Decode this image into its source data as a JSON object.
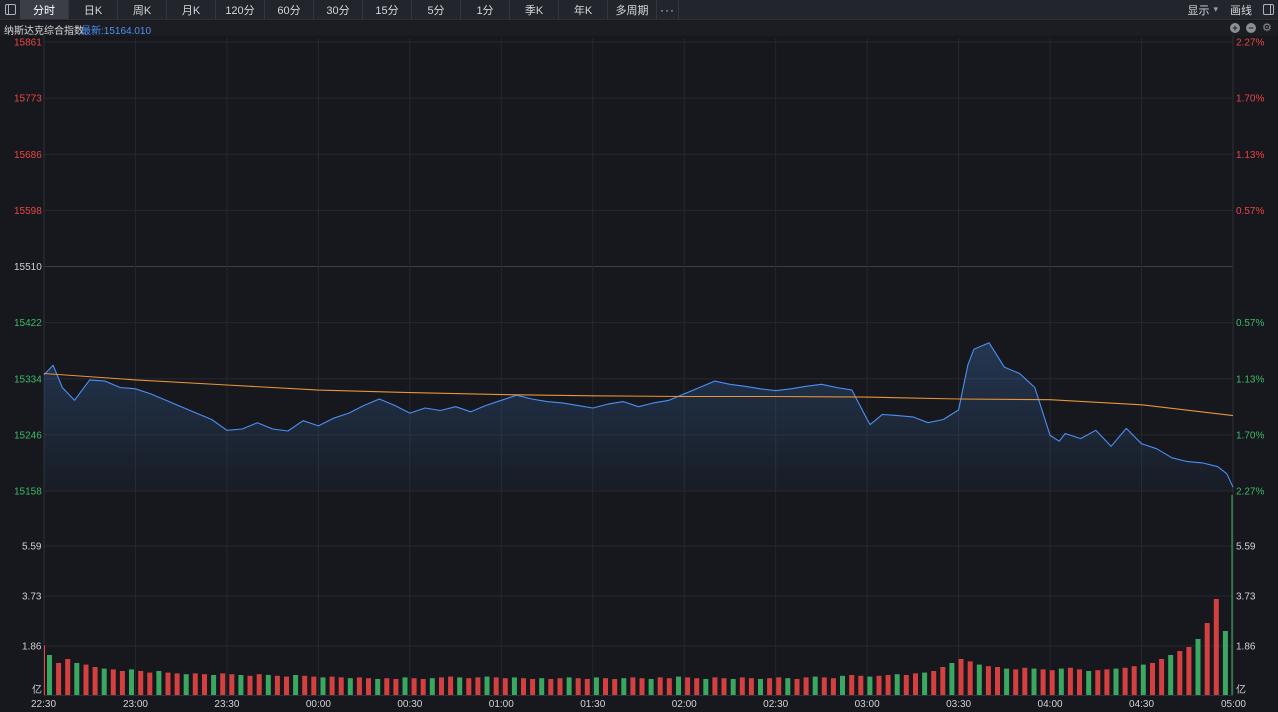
{
  "toolbar": {
    "tabs": [
      "分时",
      "日K",
      "周K",
      "月K",
      "120分",
      "60分",
      "30分",
      "15分",
      "5分",
      "1分",
      "季K",
      "年K",
      "多周期"
    ],
    "more": "···",
    "display": "显示",
    "draw": "画线"
  },
  "info": {
    "name": "纳斯达克综合指数",
    "latest": "最新:15164.010"
  },
  "colors": {
    "price_line": "#4a8ff5",
    "avg_line": "#e8943a",
    "up": "#e94545",
    "down": "#3fb86a",
    "neutral": "#cfd2d7",
    "background": "#16181d"
  },
  "chart_data": {
    "type": "line",
    "x_ticks": [
      "22:30",
      "23:00",
      "23:30",
      "00:00",
      "00:30",
      "01:00",
      "01:30",
      "02:00",
      "02:30",
      "03:00",
      "03:30",
      "04:00",
      "04:30",
      "05:00"
    ],
    "y_labels_left": [
      "15861",
      "15773",
      "15686",
      "15598",
      "15510",
      "15422",
      "15334",
      "15246",
      "15158"
    ],
    "y_labels_right": [
      "2.27%",
      "1.70%",
      "1.13%",
      "0.57%",
      "",
      "0.57%",
      "1.13%",
      "1.70%",
      "2.27%"
    ],
    "y_label_colors": [
      "up",
      "up",
      "up",
      "up",
      "neutral",
      "down",
      "down",
      "down",
      "down"
    ],
    "ylim": [
      15158,
      15861
    ],
    "reference_close": 15510,
    "price": {
      "x": [
        "22:30",
        "22:33",
        "22:36",
        "22:40",
        "22:45",
        "22:50",
        "22:55",
        "23:00",
        "23:05",
        "23:10",
        "23:15",
        "23:20",
        "23:25",
        "23:30",
        "23:35",
        "23:40",
        "23:45",
        "23:50",
        "23:55",
        "00:00",
        "00:05",
        "00:10",
        "00:15",
        "00:20",
        "00:25",
        "00:30",
        "00:35",
        "00:40",
        "00:45",
        "00:50",
        "00:55",
        "01:00",
        "01:05",
        "01:10",
        "01:15",
        "01:20",
        "01:25",
        "01:30",
        "01:35",
        "01:40",
        "01:45",
        "01:50",
        "01:55",
        "02:00",
        "02:05",
        "02:10",
        "02:15",
        "02:20",
        "02:25",
        "02:30",
        "02:35",
        "02:40",
        "02:45",
        "02:50",
        "02:55",
        "03:00",
        "03:01",
        "03:05",
        "03:10",
        "03:15",
        "03:20",
        "03:25",
        "03:30",
        "03:33",
        "03:35",
        "03:40",
        "03:45",
        "03:50",
        "03:55",
        "04:00",
        "04:03",
        "04:05",
        "04:10",
        "04:15",
        "04:20",
        "04:25",
        "04:30",
        "04:35",
        "04:40",
        "04:45",
        "04:50",
        "04:55",
        "04:58",
        "05:00"
      ],
      "y": [
        15340,
        15355,
        15320,
        15300,
        15332,
        15330,
        15320,
        15318,
        15310,
        15300,
        15290,
        15280,
        15270,
        15253,
        15255,
        15265,
        15255,
        15252,
        15268,
        15260,
        15272,
        15280,
        15292,
        15302,
        15292,
        15280,
        15288,
        15284,
        15290,
        15282,
        15292,
        15300,
        15308,
        15302,
        15298,
        15296,
        15292,
        15288,
        15294,
        15298,
        15290,
        15296,
        15300,
        15310,
        15320,
        15330,
        15325,
        15322,
        15318,
        15315,
        15318,
        15322,
        15325,
        15320,
        15316,
        15270,
        15262,
        15278,
        15276,
        15274,
        15265,
        15270,
        15285,
        15355,
        15380,
        15390,
        15352,
        15342,
        15320,
        15245,
        15236,
        15248,
        15240,
        15253,
        15228,
        15256,
        15232,
        15224,
        15210,
        15204,
        15202,
        15196,
        15185,
        15164
      ]
    },
    "average": {
      "x": [
        "22:30",
        "23:00",
        "23:30",
        "00:00",
        "00:30",
        "01:00",
        "01:30",
        "02:00",
        "02:30",
        "03:00",
        "03:30",
        "04:00",
        "04:30",
        "05:00"
      ],
      "y": [
        15342,
        15332,
        15324,
        15316,
        15312,
        15309,
        15307,
        15306,
        15306,
        15305,
        15302,
        15301,
        15293,
        15276
      ]
    },
    "volume_labels": [
      "5.59",
      "3.73",
      "1.86"
    ],
    "volume_unit": "亿",
    "volume": [
      0.5,
      0.4,
      0.45,
      0.4,
      0.38,
      0.35,
      0.33,
      0.32,
      0.3,
      0.32,
      0.3,
      0.28,
      0.3,
      0.28,
      0.27,
      0.26,
      0.27,
      0.26,
      0.25,
      0.27,
      0.26,
      0.25,
      0.24,
      0.26,
      0.25,
      0.24,
      0.23,
      0.25,
      0.24,
      0.23,
      0.22,
      0.23,
      0.22,
      0.21,
      0.22,
      0.21,
      0.2,
      0.21,
      0.2,
      0.22,
      0.21,
      0.2,
      0.21,
      0.22,
      0.23,
      0.22,
      0.21,
      0.22,
      0.23,
      0.22,
      0.21,
      0.22,
      0.21,
      0.2,
      0.21,
      0.2,
      0.21,
      0.22,
      0.21,
      0.2,
      0.22,
      0.21,
      0.2,
      0.21,
      0.22,
      0.21,
      0.2,
      0.22,
      0.21,
      0.23,
      0.22,
      0.21,
      0.2,
      0.22,
      0.21,
      0.2,
      0.22,
      0.21,
      0.2,
      0.21,
      0.22,
      0.21,
      0.2,
      0.22,
      0.23,
      0.22,
      0.21,
      0.24,
      0.25,
      0.24,
      0.23,
      0.24,
      0.25,
      0.26,
      0.25,
      0.27,
      0.28,
      0.3,
      0.35,
      0.4,
      0.45,
      0.42,
      0.38,
      0.36,
      0.35,
      0.33,
      0.32,
      0.34,
      0.33,
      0.32,
      0.31,
      0.33,
      0.34,
      0.32,
      0.3,
      0.31,
      0.32,
      0.33,
      0.34,
      0.36,
      0.38,
      0.4,
      0.45,
      0.5,
      0.55,
      0.6,
      0.7,
      0.9,
      1.2,
      0.8
    ],
    "volume_first_bar": 1.86
  }
}
